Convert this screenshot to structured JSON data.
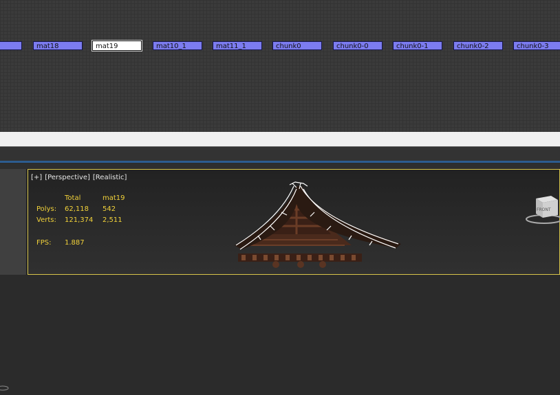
{
  "schematic": {
    "nodes": [
      {
        "label": "",
        "selected": false
      },
      {
        "label": "mat18",
        "selected": false
      },
      {
        "label": "mat19",
        "selected": true
      },
      {
        "label": "mat10_1",
        "selected": false
      },
      {
        "label": "mat11_1",
        "selected": false
      },
      {
        "label": "chunk0",
        "selected": false
      },
      {
        "label": "chunk0-0",
        "selected": false
      },
      {
        "label": "chunk0-1",
        "selected": false
      },
      {
        "label": "chunk0-2",
        "selected": false
      },
      {
        "label": "chunk0-3",
        "selected": false
      }
    ]
  },
  "viewport": {
    "label_plus": "[+]",
    "label_view": "[Perspective]",
    "label_shading": "[Realistic]",
    "stats": {
      "header_total": "Total",
      "header_selected": "mat19",
      "polys_label": "Polys:",
      "polys_total": "62,118",
      "polys_selected": "542",
      "verts_label": "Verts:",
      "verts_total": "121,374",
      "verts_selected": "2,511",
      "fps_label": "FPS:",
      "fps_value": "1.887"
    },
    "viewcube_label": "FRONT"
  },
  "colors": {
    "node_fill": "#7c7cf0",
    "stats_text": "#f2d23a",
    "viewport_border": "#d8c64a"
  }
}
